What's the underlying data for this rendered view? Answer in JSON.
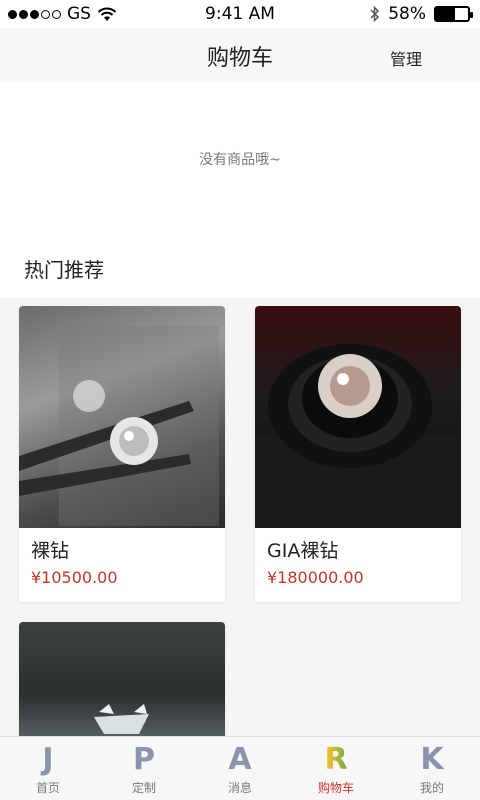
{
  "status_bar": {
    "carrier": "GS",
    "time": "9:41 AM",
    "battery_percent": "58%",
    "battery_level": 0.58,
    "signal_full": 3,
    "signal_total": 5
  },
  "nav": {
    "title": "购物车",
    "manage_label": "管理"
  },
  "cart": {
    "empty_text": "没有商品哦~"
  },
  "recommend": {
    "title": "热门推荐",
    "products": [
      {
        "name": "裸钻",
        "price": "¥10500.00"
      },
      {
        "name": "GIA裸钻",
        "price": "¥180000.00"
      },
      {
        "name": "",
        "price": ""
      }
    ]
  },
  "tabbar": {
    "items": [
      {
        "icon": "J",
        "label": "首页"
      },
      {
        "icon": "P",
        "label": "定制"
      },
      {
        "icon": "A",
        "label": "消息"
      },
      {
        "icon": "R",
        "label": "购物车"
      },
      {
        "icon": "K",
        "label": "我的"
      }
    ],
    "active_color": "#d0312d"
  },
  "colors": {
    "price": "#c0392b",
    "tab_icon": "#8b94ad"
  }
}
